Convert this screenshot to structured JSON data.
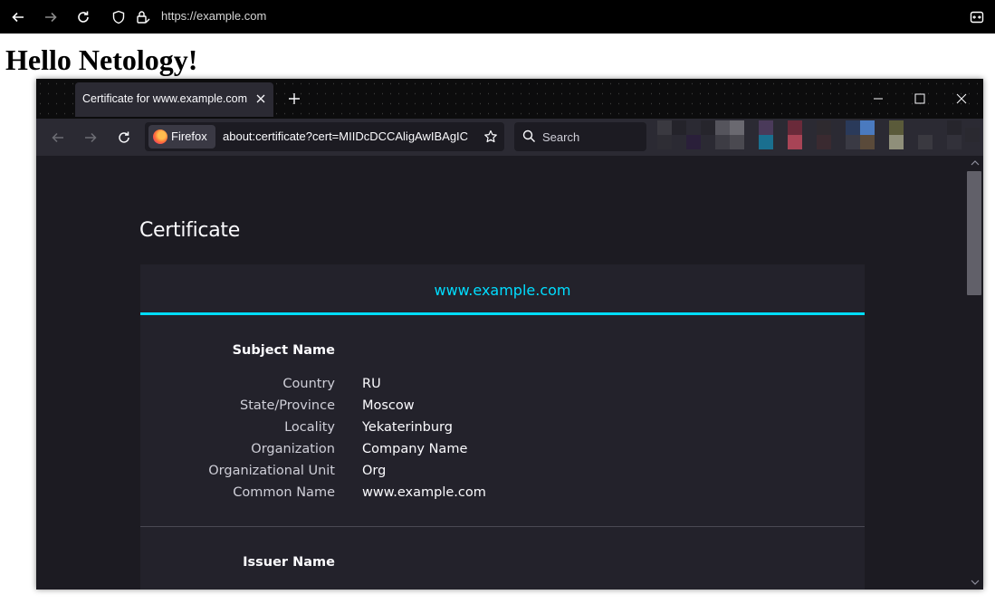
{
  "outer_browser": {
    "url": "https://example.com"
  },
  "page": {
    "heading": "Hello Netology!"
  },
  "inner_browser": {
    "tab_title": "Certificate for www.example.com",
    "identity_label": "Firefox",
    "url": "about:certificate?cert=MIIDcDCCAligAwIBAgIC",
    "search_placeholder": "Search"
  },
  "certificate": {
    "page_title": "Certificate",
    "tab_label": "www.example.com",
    "subject": {
      "title": "Subject Name",
      "rows": [
        {
          "label": "Country",
          "value": "RU"
        },
        {
          "label": "State/Province",
          "value": "Moscow"
        },
        {
          "label": "Locality",
          "value": "Yekaterinburg"
        },
        {
          "label": "Organization",
          "value": "Company Name"
        },
        {
          "label": "Organizational Unit",
          "value": "Org"
        },
        {
          "label": "Common Name",
          "value": "www.example.com"
        }
      ]
    },
    "issuer": {
      "title": "Issuer Name"
    }
  },
  "icons": {
    "outer": [
      "back-arrow-icon",
      "forward-arrow-icon",
      "reload-icon",
      "shield-icon",
      "lock-icon",
      "reader-view-icon"
    ],
    "inner": [
      "close-icon",
      "plus-icon",
      "minimize-icon",
      "maximize-icon",
      "window-close-icon",
      "back-arrow-icon",
      "forward-arrow-icon",
      "reload-icon",
      "firefox-logo-icon",
      "star-icon",
      "search-icon"
    ]
  },
  "colors": {
    "accent": "#00ddff",
    "content_bg": "#1c1b22",
    "card_bg": "#23222b",
    "toolbar_bg": "#2b2a33"
  }
}
